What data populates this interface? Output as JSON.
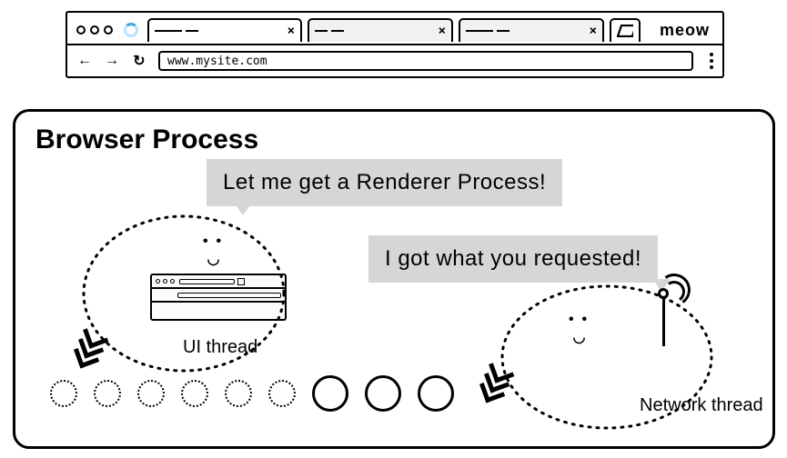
{
  "browser": {
    "brand": "meow",
    "url": "www.mysite.com",
    "tabs": [
      {
        "active": true
      },
      {
        "active": false
      },
      {
        "active": false
      }
    ]
  },
  "panel": {
    "title": "Browser Process",
    "speech_ui": "Let me get a Renderer Process!",
    "speech_net": "I got what you requested!",
    "label_ui": "UI thread",
    "label_net": "Network thread"
  }
}
